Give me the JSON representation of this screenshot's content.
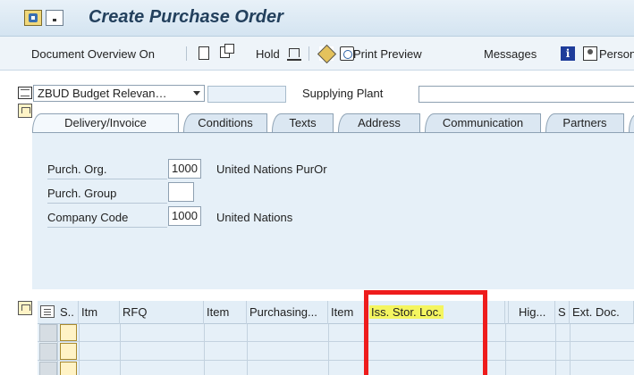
{
  "window": {
    "title": "Create Purchase Order"
  },
  "toolbar": {
    "document_overview": "Document Overview On",
    "hold": "Hold",
    "print_preview": "Print Preview",
    "messages": "Messages",
    "personal": "Person"
  },
  "header": {
    "doc_type_value": "ZBUD Budget Relevan…",
    "po_number_value": "",
    "supplying_plant_label": "Supplying Plant",
    "supplying_plant_value": ""
  },
  "tabs": [
    {
      "label": "Delivery/Invoice",
      "active": true
    },
    {
      "label": "Conditions",
      "active": false
    },
    {
      "label": "Texts",
      "active": false
    },
    {
      "label": "Address",
      "active": false
    },
    {
      "label": "Communication",
      "active": false
    },
    {
      "label": "Partners",
      "active": false
    }
  ],
  "org_data": {
    "purch_org": {
      "label": "Purch. Org.",
      "value": "1000",
      "text": "United Nations PurOr"
    },
    "purch_group": {
      "label": "Purch. Group",
      "value": "",
      "text": ""
    },
    "company_code": {
      "label": "Company Code",
      "value": "1000",
      "text": "United Nations"
    }
  },
  "item_table": {
    "columns": [
      "S..",
      "Itm",
      "RFQ",
      "Item",
      "Purchasing...",
      "Item",
      "Iss. Stor. Loc.",
      "",
      "Hig...",
      "S",
      "Ext. Doc."
    ],
    "highlighted_column": "Iss. Stor. Loc.",
    "rows": [
      {},
      {},
      {}
    ]
  },
  "colors": {
    "highlight": "#f4f560",
    "callout_frame": "#ee1c1c",
    "panel_bg": "#e6f0f8"
  }
}
